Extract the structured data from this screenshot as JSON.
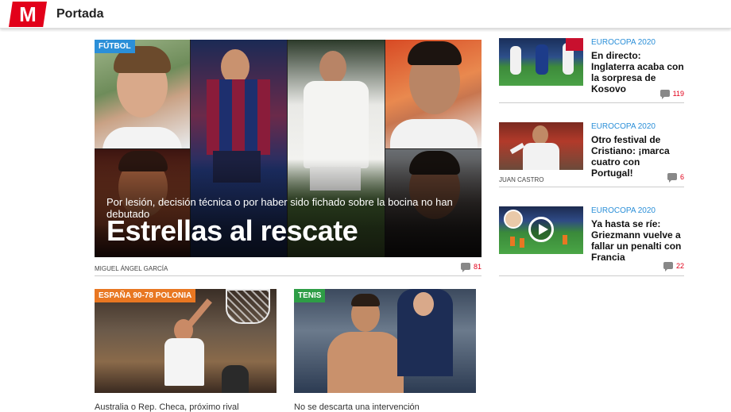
{
  "header": {
    "logo": "M",
    "section": "Portada"
  },
  "lead": {
    "tag": "FÚTBOL",
    "subtitle": "Por lesión, decisión técnica o por haber sido fichado sobre la bocina no han debutado",
    "headline": "Estrellas al rescate",
    "author": "MIGUEL ÁNGEL GARCÍA",
    "comments": "81"
  },
  "side": [
    {
      "category": "EUROCOPA 2020",
      "headline": "En directo: Inglaterra acaba con la sorpresa de Kosovo",
      "author": "",
      "comments": "119"
    },
    {
      "category": "EUROCOPA 2020",
      "headline": "Otro festival de Cristiano: ¡marca cuatro con Portugal!",
      "author": "JUAN CASTRO",
      "comments": "6"
    },
    {
      "category": "EUROCOPA 2020",
      "headline": "Ya hasta se ríe: Griezmann vuelve a fallar un penalti con Francia",
      "author": "",
      "comments": "22"
    }
  ],
  "cards": [
    {
      "tag": "ESPAÑA 90-78 POLONIA",
      "caption": "Australia o Rep. Checa, próximo rival"
    },
    {
      "tag": "TENIS",
      "caption": "No se descarta una intervención"
    }
  ],
  "colors": {
    "brand": "#e2001a",
    "category": "#2b8fd8",
    "futbol_tag": "#2b8fd8",
    "espana_tag": "#e87722",
    "tenis_tag": "#2e9d46"
  }
}
